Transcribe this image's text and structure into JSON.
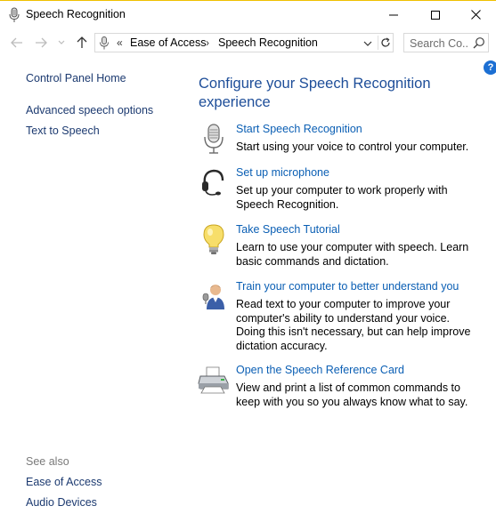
{
  "window": {
    "title": "Speech Recognition"
  },
  "address_bar": {
    "overflow": "«",
    "crumbs": [
      "Ease of Access",
      "Speech Recognition"
    ],
    "separator": "›"
  },
  "search": {
    "placeholder": "Search Co..."
  },
  "help": {
    "label": "?"
  },
  "left_pane": {
    "home": "Control Panel Home",
    "links": [
      "Advanced speech options",
      "Text to Speech"
    ],
    "see_also_title": "See also",
    "see_also": [
      "Ease of Access",
      "Audio Devices"
    ]
  },
  "main": {
    "heading": "Configure your Speech Recognition experience",
    "tasks": [
      {
        "title": "Start Speech Recognition",
        "description": "Start using your voice to control your computer.",
        "icon": "microphone-icon"
      },
      {
        "title": "Set up microphone",
        "description": "Set up your computer to work properly with Speech Recognition.",
        "icon": "headset-icon"
      },
      {
        "title": "Take Speech Tutorial",
        "description": "Learn to use your computer with speech.  Learn basic commands and dictation.",
        "icon": "lightbulb-icon"
      },
      {
        "title": "Train your computer to better understand you",
        "description": "Read text to your computer to improve your computer's ability to understand your voice. Doing this isn't necessary, but can help improve dictation accuracy.",
        "icon": "user-train-icon"
      },
      {
        "title": "Open the Speech Reference Card",
        "description": "View and print a list of common commands to keep with you so you always know what to say.",
        "icon": "printer-icon"
      }
    ]
  },
  "colors": {
    "link": "#0b5fb4",
    "heading": "#1e4e99",
    "left_link": "#1c3a70",
    "help_badge": "#1c6fd3"
  }
}
